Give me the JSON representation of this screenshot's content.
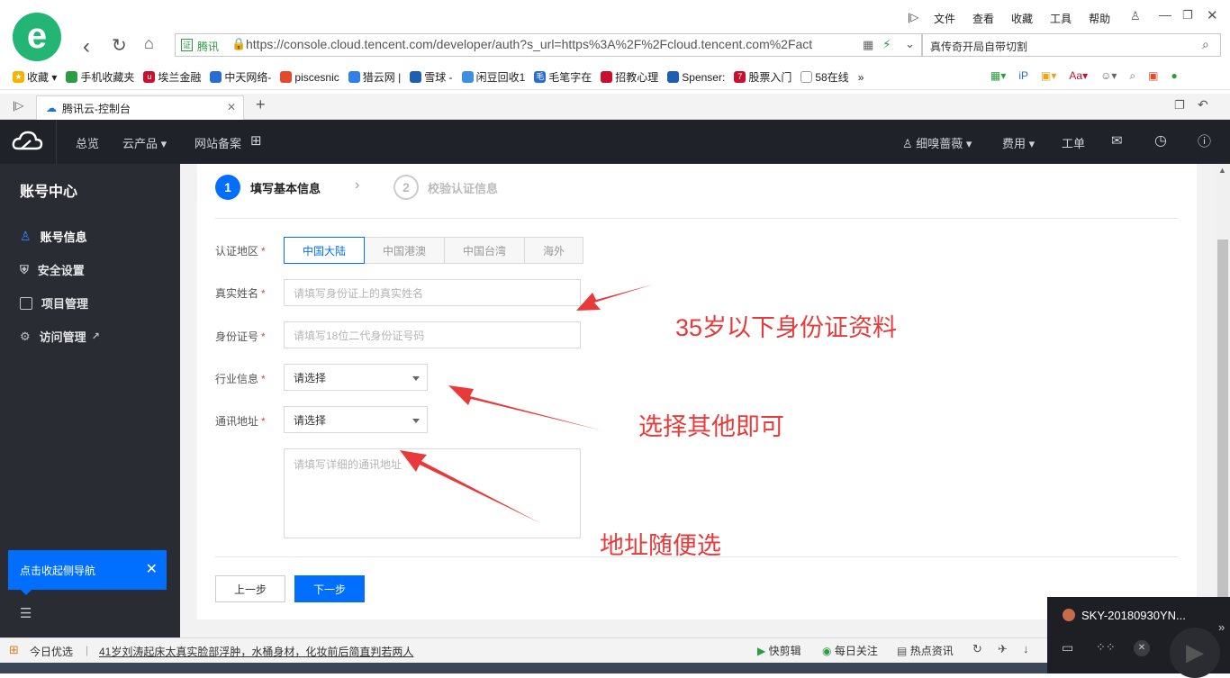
{
  "browser": {
    "menu": [
      "文件",
      "查看",
      "收藏",
      "工具",
      "帮助"
    ],
    "site_badge": "腾讯",
    "url": "https://console.cloud.tencent.com/developer/auth?s_url=https%3A%2F%2Fcloud.tencent.com%2Fact",
    "search_placeholder": "真传奇开局自带切割",
    "bookmarks": [
      "收藏",
      "手机收藏夹",
      "埃兰金融",
      "中天网络-",
      "piscesnic",
      "猎云网 |",
      "雪球 -",
      "闲豆回收1",
      "毛笔字在",
      "招教心理",
      "Spenser:",
      "股票入门",
      "58在线"
    ],
    "tab_title": "腾讯云-控制台",
    "status_items": [
      "今日优选",
      "41岁刘涛起床太真实脸部浮肿，水桶身材，化妆前后简直判若两人",
      "快剪辑",
      "每日关注",
      "热点资讯"
    ]
  },
  "topnav": {
    "items": [
      "总览",
      "云产品",
      "网站备案"
    ],
    "user": "细嗅蔷薇",
    "fee": "费用",
    "ticket": "工单"
  },
  "sidebar": {
    "title": "账号中心",
    "items": [
      {
        "label": "账号信息",
        "active": true
      },
      {
        "label": "安全设置",
        "active": false
      },
      {
        "label": "项目管理",
        "active": false
      },
      {
        "label": "访问管理",
        "active": false
      }
    ],
    "collapse_tip": "点击收起侧导航"
  },
  "steps": [
    {
      "num": "1",
      "label": "填写基本信息",
      "active": true
    },
    {
      "num": "2",
      "label": "校验认证信息",
      "active": false
    }
  ],
  "form": {
    "region_label": "认证地区",
    "regions": [
      "中国大陆",
      "中国港澳",
      "中国台湾",
      "海外"
    ],
    "name_label": "真实姓名",
    "name_placeholder": "请填写身份证上的真实姓名",
    "id_label": "身份证号",
    "id_placeholder": "请填写18位二代身份证号码",
    "industry_label": "行业信息",
    "industry_value": "请选择",
    "address_label": "通讯地址",
    "address_value": "请选择",
    "address_placeholder": "请填写详细的通讯地址",
    "prev_button": "上一步",
    "next_button": "下一步"
  },
  "annotations": {
    "note1": "35岁以下身份证资料",
    "note2": "选择其他即可",
    "note3": "地址随便选"
  },
  "popup": {
    "title": "SKY-20180930YN..."
  },
  "colors": {
    "accent": "#006eff",
    "annotation": "#e83a3a",
    "nav_bg": "#1f2229",
    "sidebar_bg": "#292c33"
  }
}
